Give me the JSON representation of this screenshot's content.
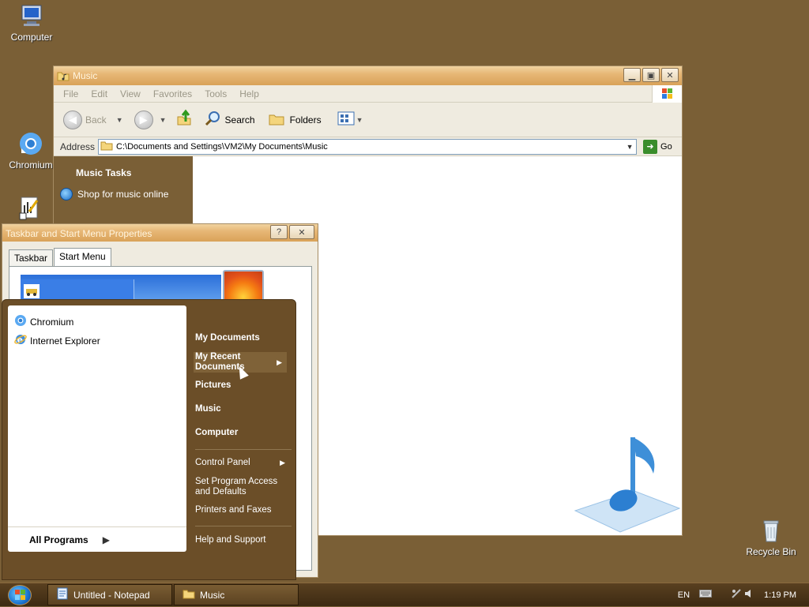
{
  "desktop": {
    "icons": [
      {
        "label": "Computer"
      },
      {
        "label": "Chromium"
      },
      {
        "label": "Recycle Bin"
      }
    ]
  },
  "music_window": {
    "title": "Music",
    "menu": [
      "File",
      "Edit",
      "View",
      "Favorites",
      "Tools",
      "Help"
    ],
    "toolbar": {
      "back": "Back",
      "search": "Search",
      "folders": "Folders"
    },
    "address_label": "Address",
    "address_value": "C:\\Documents and Settings\\VM2\\My Documents\\Music",
    "go_label": "Go",
    "tasks_header": "Music Tasks",
    "tasks_link": "Shop for music online"
  },
  "props_dialog": {
    "title": "Taskbar and Start Menu Properties",
    "help_btn": "?",
    "close_btn": "✕",
    "tabs": [
      "Taskbar",
      "Start Menu"
    ]
  },
  "start_menu": {
    "pinned": [
      "Chromium",
      "Internet Explorer"
    ],
    "all_programs": "All Programs",
    "right": {
      "my_documents": "My Documents",
      "my_recent_documents": "My Recent Documents",
      "pictures": "Pictures",
      "music": "Music",
      "computer": "Computer",
      "control_panel": "Control Panel",
      "set_program_access": "Set Program Access and Defaults",
      "printers_faxes": "Printers and Faxes",
      "help_support": "Help and Support"
    }
  },
  "taskbar": {
    "buttons": [
      "Untitled - Notepad",
      "Music"
    ],
    "lang": "EN",
    "clock": "1:19 PM"
  },
  "colors": {
    "desktop": "#7a5f36",
    "title_bar": "#e7b776",
    "start_menu": "#6b4e28"
  }
}
